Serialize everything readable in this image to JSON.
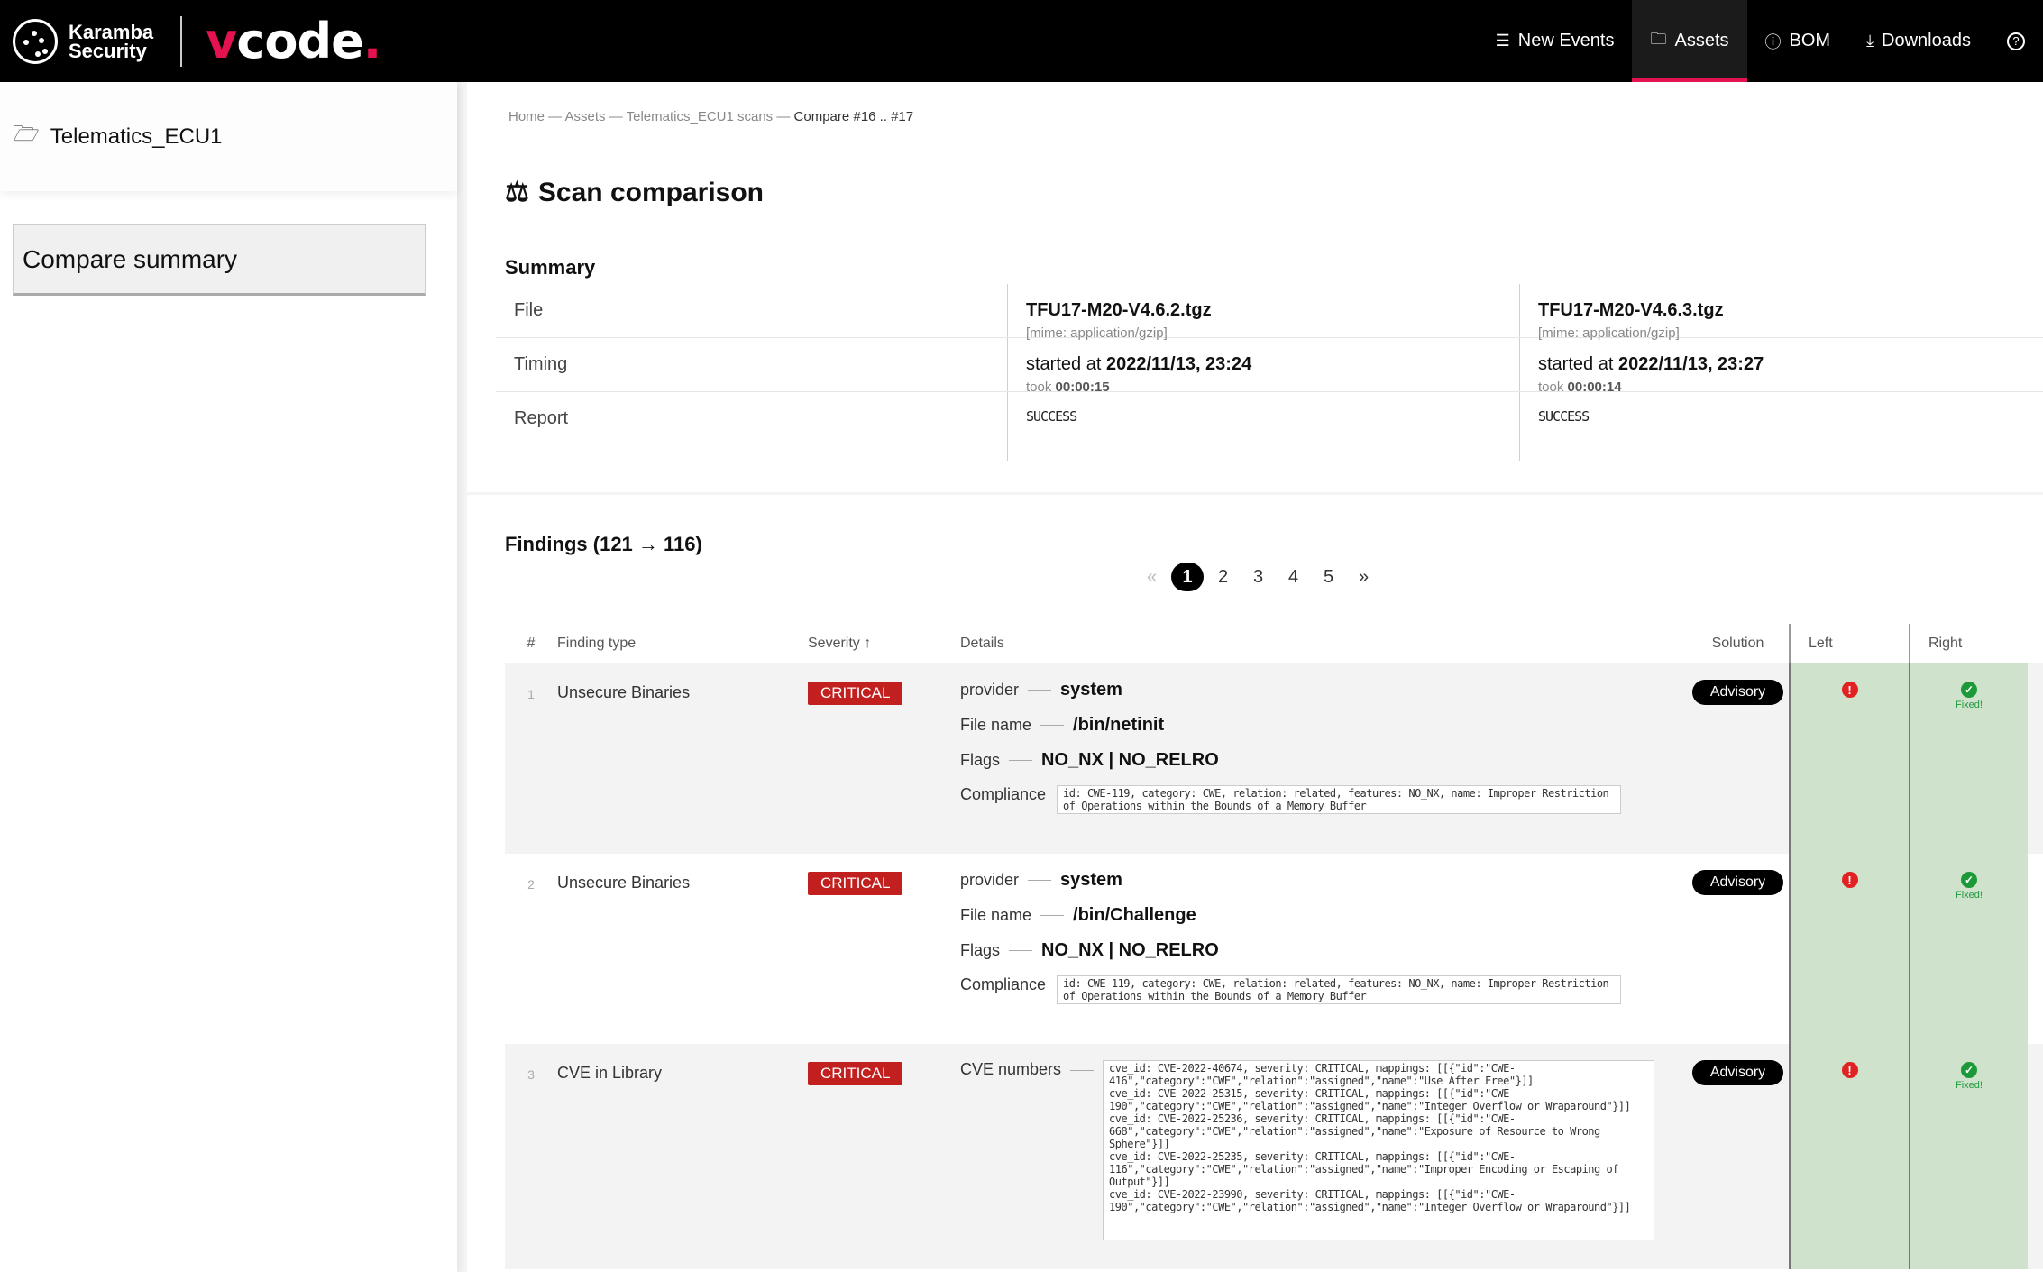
{
  "brand": {
    "company_line1": "Karamba",
    "company_line2": "Security",
    "product_v": "v",
    "product_rest": "code",
    "product_dot": "."
  },
  "nav": {
    "items": [
      {
        "label": "New Events",
        "icon": "list-icon"
      },
      {
        "label": "Assets",
        "icon": "folder-icon",
        "active": true
      },
      {
        "label": "BOM",
        "icon": "info-icon"
      },
      {
        "label": "Downloads",
        "icon": "download-icon"
      }
    ],
    "help_icon": "help-icon"
  },
  "sidebar": {
    "asset_name": "Telematics_ECU1",
    "section": "Compare summary"
  },
  "breadcrumb": {
    "home": "Home",
    "assets": "Assets",
    "scans": "Telematics_ECU1 scans",
    "current": "Compare #16 .. #17",
    "sep": " — "
  },
  "page": {
    "title": "Scan comparison"
  },
  "summary": {
    "heading": "Summary",
    "labels": {
      "file": "File",
      "timing": "Timing",
      "report": "Report"
    },
    "left": {
      "file": "TFU17-M20-V4.6.2.tgz",
      "mime": "[mime: application/gzip]",
      "started_prefix": "started at",
      "started": "2022/11/13, 23:24",
      "took_prefix": "took",
      "took": "00:00:15",
      "status": "SUCCESS"
    },
    "right": {
      "file": "TFU17-M20-V4.6.3.tgz",
      "mime": "[mime: application/gzip]",
      "started_prefix": "started at",
      "started": "2022/11/13, 23:27",
      "took_prefix": "took",
      "took": "00:00:14",
      "status": "SUCCESS"
    }
  },
  "findings": {
    "heading": "Findings (121 → 116)",
    "pager": {
      "first": "«",
      "pages": [
        "1",
        "2",
        "3",
        "4",
        "5"
      ],
      "current": "1",
      "last": "»"
    },
    "columns": {
      "num": "#",
      "type": "Finding type",
      "severity": "Severity ↑",
      "details": "Details",
      "solution": "Solution",
      "left": "Left",
      "right": "Right"
    },
    "fixed_label": "Fixed!",
    "rows": [
      {
        "num": "1",
        "type": "Unsecure Binaries",
        "severity": "CRITICAL",
        "provider_key": "provider",
        "provider": "system",
        "file_key": "File name",
        "file": "/bin/netinit",
        "flags_key": "Flags",
        "flags": "NO_NX | NO_RELRO",
        "compliance_key": "Compliance",
        "compliance": "id: CWE-119, category: CWE, relation: related, features: NO_NX, name: Improper Restriction of Operations within the Bounds of a Memory Buffer",
        "solution": "Advisory"
      },
      {
        "num": "2",
        "type": "Unsecure Binaries",
        "severity": "CRITICAL",
        "provider_key": "provider",
        "provider": "system",
        "file_key": "File name",
        "file": "/bin/Challenge",
        "flags_key": "Flags",
        "flags": "NO_NX | NO_RELRO",
        "compliance_key": "Compliance",
        "compliance": "id: CWE-119, category: CWE, relation: related, features: NO_NX, name: Improper Restriction of Operations within the Bounds of a Memory Buffer",
        "solution": "Advisory"
      },
      {
        "num": "3",
        "type": "CVE in Library",
        "severity": "CRITICAL",
        "cve_key": "CVE numbers",
        "cves": "cve_id: CVE-2022-40674, severity: CRITICAL, mappings: [[{\"id\":\"CWE-416\",\"category\":\"CWE\",\"relation\":\"assigned\",\"name\":\"Use After Free\"}]]\ncve_id: CVE-2022-25315, severity: CRITICAL, mappings: [[{\"id\":\"CWE-190\",\"category\":\"CWE\",\"relation\":\"assigned\",\"name\":\"Integer Overflow or Wraparound\"}]]\ncve_id: CVE-2022-25236, severity: CRITICAL, mappings: [[{\"id\":\"CWE-668\",\"category\":\"CWE\",\"relation\":\"assigned\",\"name\":\"Exposure of Resource to Wrong Sphere\"}]]\ncve_id: CVE-2022-25235, severity: CRITICAL, mappings: [[{\"id\":\"CWE-116\",\"category\":\"CWE\",\"relation\":\"assigned\",\"name\":\"Improper Encoding or Escaping of Output\"}]]\ncve_id: CVE-2022-23990, severity: CRITICAL, mappings: [[{\"id\":\"CWE-190\",\"category\":\"CWE\",\"relation\":\"assigned\",\"name\":\"Integer Overflow or Wraparound\"}]]",
        "solution": "Advisory"
      }
    ]
  }
}
